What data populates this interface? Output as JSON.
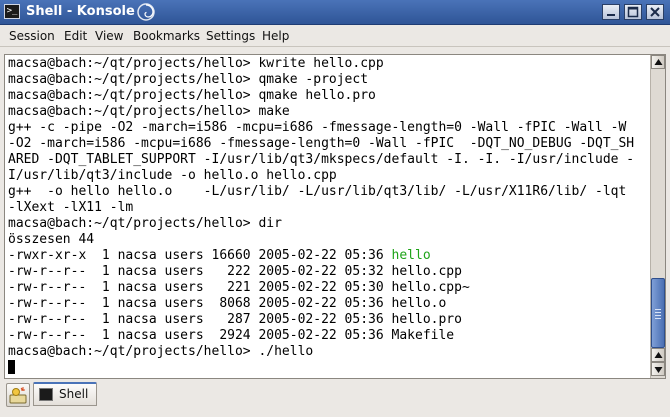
{
  "window": {
    "title": "Shell - Konsole",
    "app_icon_text": ">_",
    "controls": [
      "minimize",
      "maximize",
      "close"
    ],
    "title_bar_color": "#3a62a8"
  },
  "menu": [
    "Session",
    "Edit",
    "View",
    "Bookmarks",
    "Settings",
    "Help"
  ],
  "terminal": {
    "lines": [
      {
        "text": "macsa@bach:~/qt/projects/hello> kwrite hello.cpp"
      },
      {
        "text": "macsa@bach:~/qt/projects/hello> qmake -project"
      },
      {
        "text": "macsa@bach:~/qt/projects/hello> qmake hello.pro"
      },
      {
        "text": "macsa@bach:~/qt/projects/hello> make"
      },
      {
        "text": "g++ -c -pipe -O2 -march=i586 -mcpu=i686 -fmessage-length=0 -Wall -fPIC -Wall -W"
      },
      {
        "text": "-O2 -march=i586 -mcpu=i686 -fmessage-length=0 -Wall -fPIC  -DQT_NO_DEBUG -DQT_SH"
      },
      {
        "text": "ARED -DQT_TABLET_SUPPORT -I/usr/lib/qt3/mkspecs/default -I. -I. -I/usr/include -"
      },
      {
        "text": "I/usr/lib/qt3/include -o hello.o hello.cpp"
      },
      {
        "text": "g++  -o hello hello.o    -L/usr/lib/ -L/usr/lib/qt3/lib/ -L/usr/X11R6/lib/ -lqt"
      },
      {
        "text": "-lXext -lX11 -lm"
      },
      {
        "text": "macsa@bach:~/qt/projects/hello> dir"
      },
      {
        "text": "összesen 44"
      },
      {
        "text": "-rwxr-xr-x  1 nacsa users 16660 2005-02-22 05:36 ",
        "highlight": "hello"
      },
      {
        "text": "-rw-r--r--  1 nacsa users   222 2005-02-22 05:32 hello.cpp"
      },
      {
        "text": "-rw-r--r--  1 nacsa users   221 2005-02-22 05:30 hello.cpp~"
      },
      {
        "text": "-rw-r--r--  1 nacsa users  8068 2005-02-22 05:36 hello.o"
      },
      {
        "text": "-rw-r--r--  1 nacsa users   287 2005-02-22 05:36 hello.pro"
      },
      {
        "text": "-rw-r--r--  1 nacsa users  2924 2005-02-22 05:36 Makefile"
      },
      {
        "text": "macsa@bach:~/qt/projects/hello> ./hello"
      },
      {
        "text": "",
        "cursor": true
      }
    ],
    "executable_color": "#1fa319",
    "scroll_position": 1.0,
    "visible_fraction": 0.25
  },
  "tabbar": {
    "new_session_icon": "new-session-icon",
    "tabs": [
      {
        "label": "Shell",
        "icon": "terminal-icon",
        "active": true
      }
    ]
  }
}
